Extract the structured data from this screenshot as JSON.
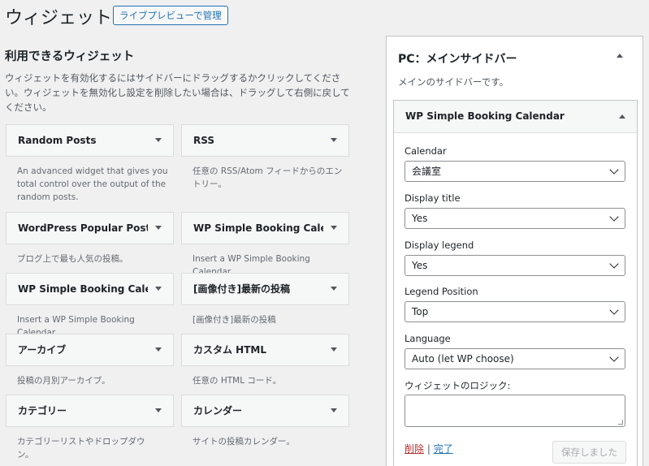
{
  "header": {
    "title": "ウィジェット",
    "live_preview_label": "ライブプレビューで管理"
  },
  "available": {
    "title": "利用できるウィジェット",
    "description": "ウィジェットを有効化するにはサイドバーにドラッグするかクリックしてください。ウィジェットを無効化し設定を削除したい場合は、ドラッグして右側に戻してください。",
    "widgets": [
      {
        "title": "Random Posts",
        "desc": "An advanced widget that gives you total control over the output of the random posts."
      },
      {
        "title": "RSS",
        "desc": "任意の RSS/Atom フィードからのエントリー。"
      },
      {
        "title": "WordPress Popular Posts",
        "desc": "ブログ上で最も人気の投稿。"
      },
      {
        "title": "WP Simple Booking Cale...",
        "desc": "Insert a WP Simple Booking Calendar"
      },
      {
        "title": "WP Simple Booking Cale...",
        "desc": "Insert a WP Simple Booking Calendar"
      },
      {
        "title": "[画像付き]最新の投稿",
        "desc": "[画像付き]最新の投稿"
      },
      {
        "title": "アーカイブ",
        "desc": "投稿の月別アーカイブ。"
      },
      {
        "title": "カスタム HTML",
        "desc": "任意の HTML コード。"
      },
      {
        "title": "カテゴリー",
        "desc": "カテゴリーリストやドロップダウン。"
      },
      {
        "title": "カレンダー",
        "desc": "サイトの投稿カレンダー。"
      }
    ]
  },
  "sidebar": {
    "title": "PC：メインサイドバー",
    "description": "メインのサイドバーです。",
    "open_widget": {
      "title": "WP Simple Booking Calendar",
      "fields": [
        {
          "label": "Calendar",
          "value": "会議室"
        },
        {
          "label": "Display title",
          "value": "Yes"
        },
        {
          "label": "Display legend",
          "value": "Yes"
        },
        {
          "label": "Legend Position",
          "value": "Top"
        },
        {
          "label": "Language",
          "value": "Auto (let WP choose)"
        }
      ],
      "logic_label": "ウィジェットのロジック:",
      "logic_value": "",
      "delete_label": "削除",
      "separator": "|",
      "done_label": "完了",
      "saved_label": "保存しました"
    }
  }
}
